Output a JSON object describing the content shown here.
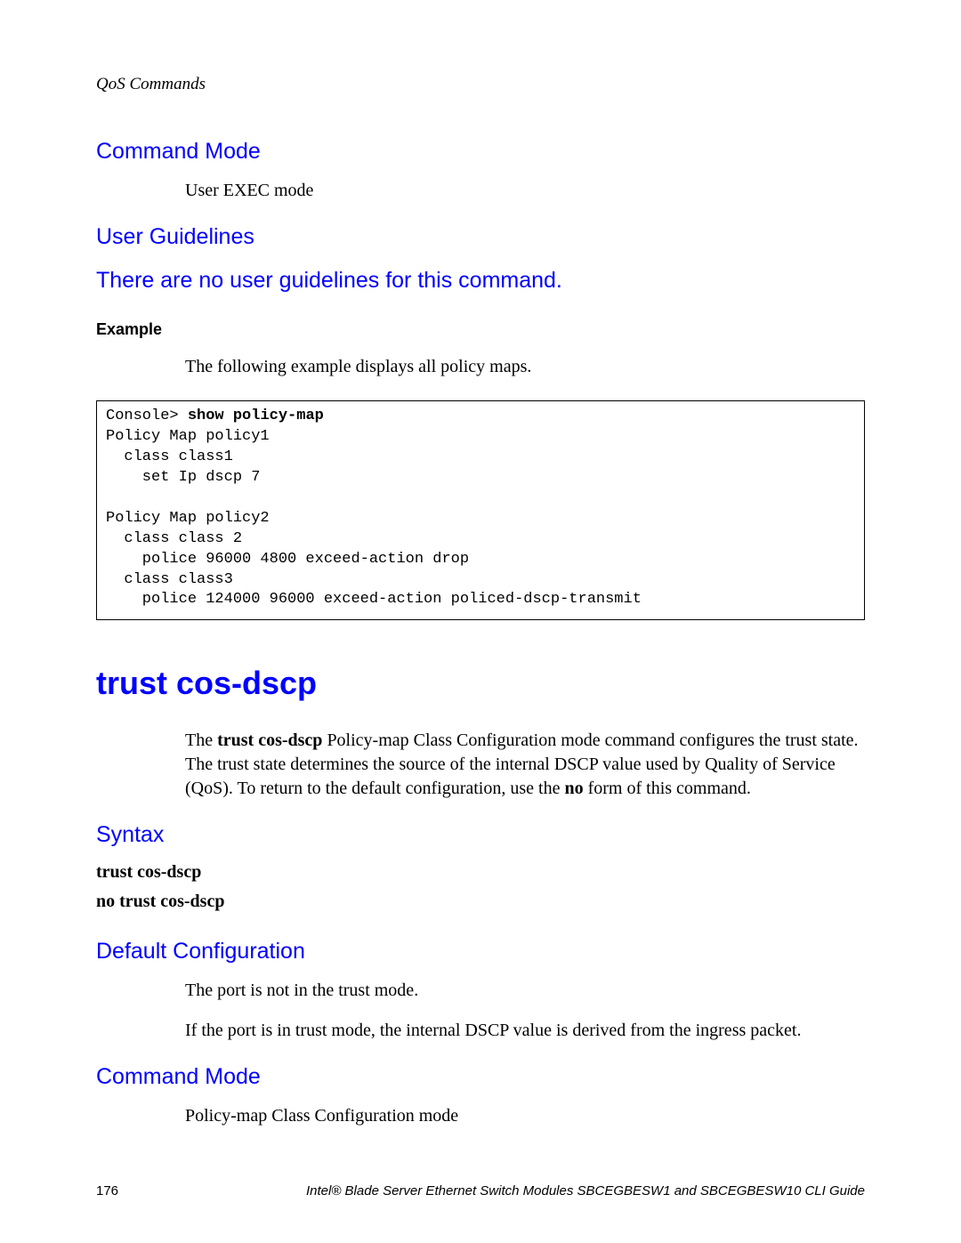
{
  "header": {
    "running": "QoS Commands"
  },
  "sections": {
    "commandMode1": {
      "heading": "Command Mode",
      "body": "User EXEC mode"
    },
    "userGuidelines": {
      "heading": "User Guidelines",
      "line": "There are no user guidelines for this command."
    },
    "example": {
      "label": "Example",
      "intro": "The following example displays all policy maps.",
      "prompt": "Console> ",
      "cmd": "show policy-map",
      "output": "Policy Map policy1\n  class class1\n    set Ip dscp 7\n\nPolicy Map policy2\n  class class 2\n    police 96000 4800 exceed-action drop\n  class class3\n    police 124000 96000 exceed-action policed-dscp-transmit"
    },
    "commandTitle": "trust cos-dscp",
    "description": {
      "pre": "The ",
      "boldCmd": "trust cos-dscp",
      "mid": " Policy-map Class Configuration mode command configures the trust state. The trust state determines the source of the internal DSCP value used by Quality of Service (QoS). To return to the default configuration, use the ",
      "boldNo": "no",
      "post": " form of this command."
    },
    "syntax": {
      "heading": "Syntax",
      "line1": "trust cos-dscp",
      "line2": "no trust cos-dscp"
    },
    "defaultConfig": {
      "heading": "Default Configuration",
      "body1": "The port is not in the trust mode.",
      "body2": "If the port is in trust mode, the internal DSCP value is derived from the ingress packet."
    },
    "commandMode2": {
      "heading": "Command Mode",
      "body": "Policy-map Class Configuration mode"
    }
  },
  "footer": {
    "pageNum": "176",
    "docTitle": "Intel® Blade Server Ethernet Switch Modules SBCEGBESW1 and SBCEGBESW10 CLI Guide"
  }
}
